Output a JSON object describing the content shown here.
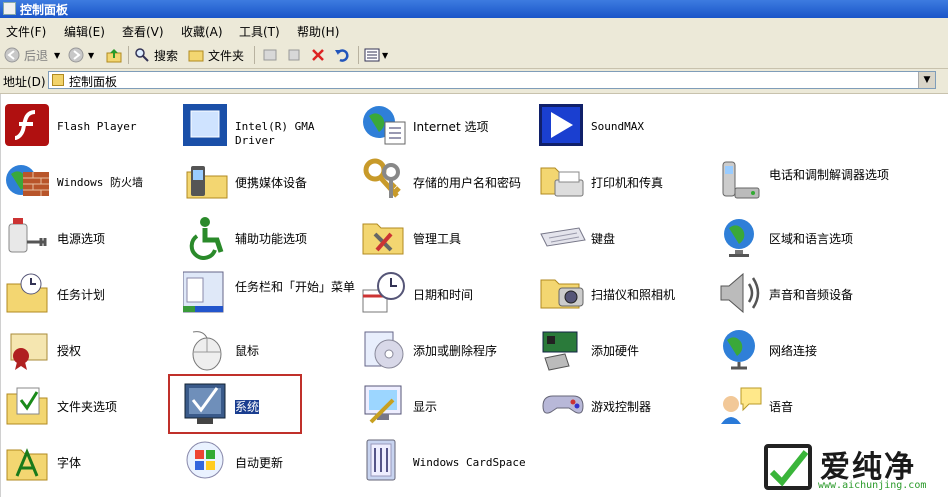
{
  "window": {
    "title": "控制面板"
  },
  "menu": [
    "文件(F)",
    "编辑(E)",
    "查看(V)",
    "收藏(A)",
    "工具(T)",
    "帮助(H)"
  ],
  "toolbar": {
    "back": "后退",
    "search": "搜索",
    "folders": "文件夹"
  },
  "address": {
    "label": "地址(D)",
    "value": "控制面板"
  },
  "items": [
    {
      "label": "Flash Player",
      "icon": "flash-player-icon"
    },
    {
      "label": "Intel(R) GMA Driver",
      "icon": "intel-gma-icon"
    },
    {
      "label": "Internet 选项",
      "icon": "internet-options-icon"
    },
    {
      "label": "SoundMAX",
      "icon": "soundmax-icon"
    },
    {
      "label": "Windows 防火墙",
      "icon": "firewall-icon"
    },
    {
      "label": "便携媒体设备",
      "icon": "portable-media-icon"
    },
    {
      "label": "存储的用户名和密码",
      "icon": "keys-icon"
    },
    {
      "label": "打印机和传真",
      "icon": "printer-icon"
    },
    {
      "label": "电话和调制解调器选项",
      "icon": "phone-modem-icon"
    },
    {
      "label": "电源选项",
      "icon": "power-icon"
    },
    {
      "label": "辅助功能选项",
      "icon": "accessibility-icon"
    },
    {
      "label": "管理工具",
      "icon": "admin-tools-icon"
    },
    {
      "label": "键盘",
      "icon": "keyboard-icon"
    },
    {
      "label": "区域和语言选项",
      "icon": "globe-icon"
    },
    {
      "label": "任务计划",
      "icon": "scheduled-tasks-icon"
    },
    {
      "label": "任务栏和「开始」菜单",
      "icon": "taskbar-icon"
    },
    {
      "label": "日期和时间",
      "icon": "datetime-icon"
    },
    {
      "label": "扫描仪和照相机",
      "icon": "scanner-icon"
    },
    {
      "label": "声音和音频设备",
      "icon": "speaker-icon"
    },
    {
      "label": "授权",
      "icon": "license-icon"
    },
    {
      "label": "鼠标",
      "icon": "mouse-icon"
    },
    {
      "label": "添加或删除程序",
      "icon": "add-remove-icon"
    },
    {
      "label": "添加硬件",
      "icon": "add-hardware-icon"
    },
    {
      "label": "网络连接",
      "icon": "network-icon"
    },
    {
      "label": "文件夹选项",
      "icon": "folder-options-icon"
    },
    {
      "label": "系统",
      "icon": "system-icon"
    },
    {
      "label": "显示",
      "icon": "display-icon"
    },
    {
      "label": "游戏控制器",
      "icon": "gamepad-icon"
    },
    {
      "label": "语音",
      "icon": "speech-icon"
    },
    {
      "label": "字体",
      "icon": "fonts-icon"
    },
    {
      "label": "自动更新",
      "icon": "windows-update-icon"
    },
    {
      "label": "Windows CardSpace",
      "icon": "cardspace-icon"
    }
  ],
  "watermark": {
    "brand": "爱纯净",
    "url": "www.aichunjing.com"
  }
}
